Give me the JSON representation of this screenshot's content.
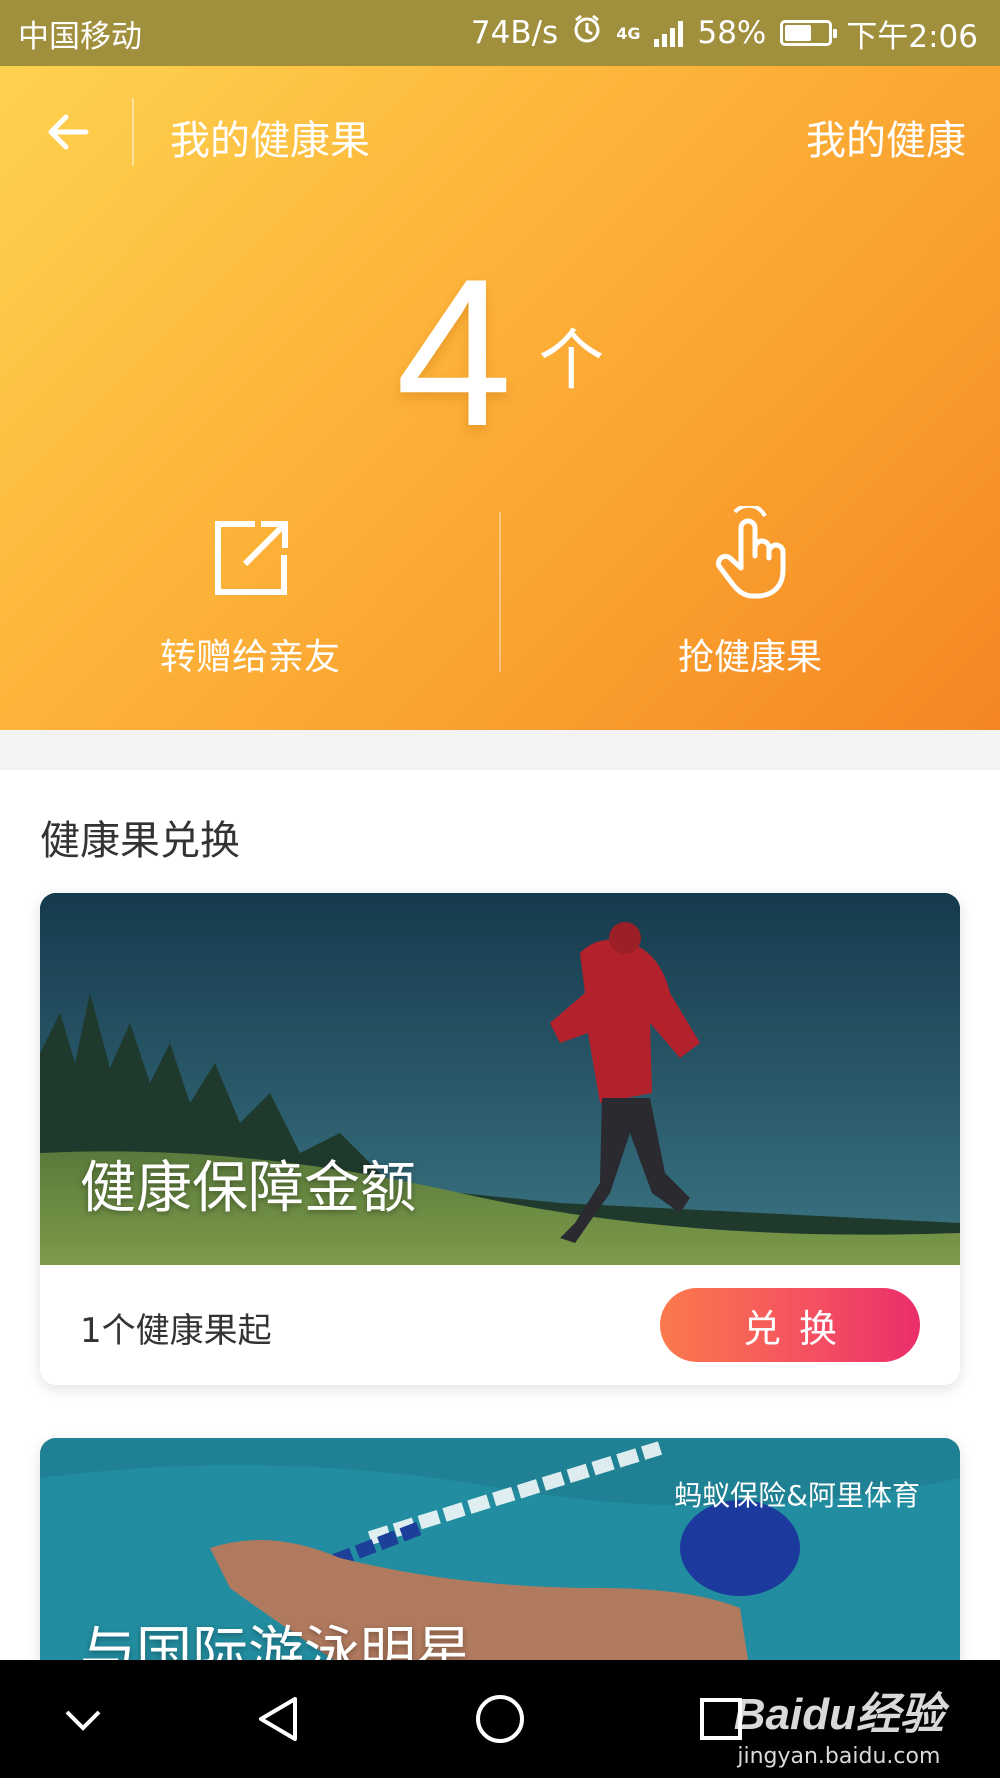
{
  "status_bar": {
    "carrier": "中国移动",
    "net_speed": "74B/s",
    "network": "4G",
    "battery_pct": "58%",
    "time": "下午2:06"
  },
  "header": {
    "title": "我的健康果",
    "right_link": "我的健康"
  },
  "balance": {
    "count": "4",
    "unit": "个"
  },
  "actions": [
    {
      "label": "转赠给亲友",
      "icon": "share-icon"
    },
    {
      "label": "抢健康果",
      "icon": "hand-tap-icon"
    }
  ],
  "exchange": {
    "section_title": "健康果兑换",
    "cards": [
      {
        "title": "健康保障金额",
        "min_label": "1个健康果起",
        "button_label": "兑换"
      },
      {
        "title": "与国际游泳明星",
        "sponsor": "蚂蚁保险&阿里体育"
      }
    ]
  },
  "navbar": {
    "watermark_logo": "Baidu经验",
    "watermark_url": "jingyan.baidu.com"
  },
  "colors": {
    "hero_start": "#fed24f",
    "hero_end": "#f48622",
    "button_start": "#fb7a4c",
    "button_end": "#ea2d6a",
    "status_bar": "#a08f3d"
  }
}
